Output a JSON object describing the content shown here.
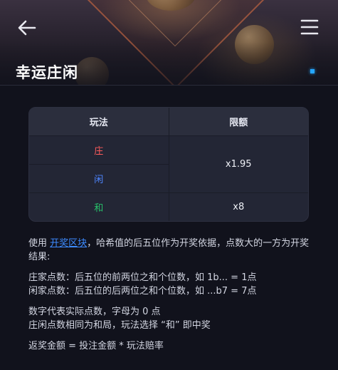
{
  "header": {
    "title": "幸运庄闲"
  },
  "table": {
    "headers": [
      "玩法",
      "限额"
    ],
    "rows": [
      {
        "label": "庄",
        "color": "#ff5b5b"
      },
      {
        "label": "闲",
        "color": "#4e86ff"
      },
      {
        "label": "和",
        "color": "#27c06a"
      }
    ],
    "limit_banker_player": "x1.95",
    "limit_tie": "x8"
  },
  "rules": {
    "intro_prefix": "使用 ",
    "intro_link": "开奖区块",
    "intro_suffix": "，哈希值的后五位作为开奖依据，点数大的一方为开奖结果:",
    "banker_points": "庄家点数：后五位的前两位之和个位数，如 1b... = 1点",
    "player_points": "闲家点数：后五位的后两位之和个位数，如 ...b7 = 7点",
    "digit_note": "数字代表实际点数，字母为 0 点",
    "tie_note": "庄闲点数相同为和局，玩法选择 “和” 即中奖",
    "payout_formula": "返奖金额 = 投注金额 * 玩法赔率"
  },
  "colors": {
    "accent": "#3d8bff",
    "indicator": "#25a6ff",
    "background": "#11121c"
  }
}
